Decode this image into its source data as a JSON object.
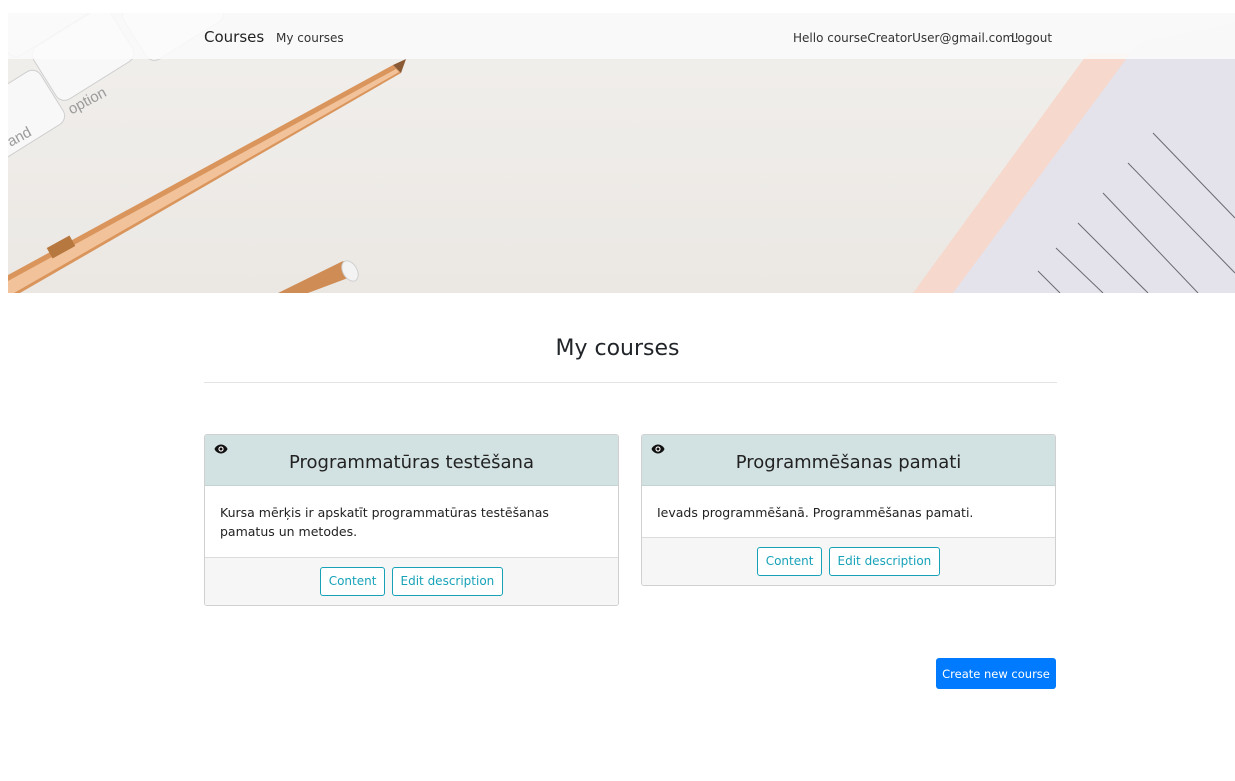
{
  "navbar": {
    "brand": "Courses",
    "my_courses_link": "My courses",
    "greeting": "Hello courseCreatorUser@gmail.com!",
    "logout": "Logout"
  },
  "hero": {
    "keyboard_keys": [
      "option",
      "and"
    ]
  },
  "main": {
    "title": "My courses",
    "courses": [
      {
        "title": "Programmatūras testēšana",
        "description": "Kursa mērķis ir apskatīt programmatūras testēšanas pamatus un metodes.",
        "content_button": "Content",
        "edit_button": "Edit description"
      },
      {
        "title": "Programmēšanas pamati",
        "description": "Ievads programmēšanā. Programmēšanas pamati.",
        "content_button": "Content",
        "edit_button": "Edit description"
      }
    ],
    "create_button": "Create new course"
  },
  "colors": {
    "card_header": "#d2e1e1",
    "outline_button": "#17a2b8",
    "primary_button": "#007bff"
  },
  "icons": {
    "visibility": "eye-icon"
  }
}
